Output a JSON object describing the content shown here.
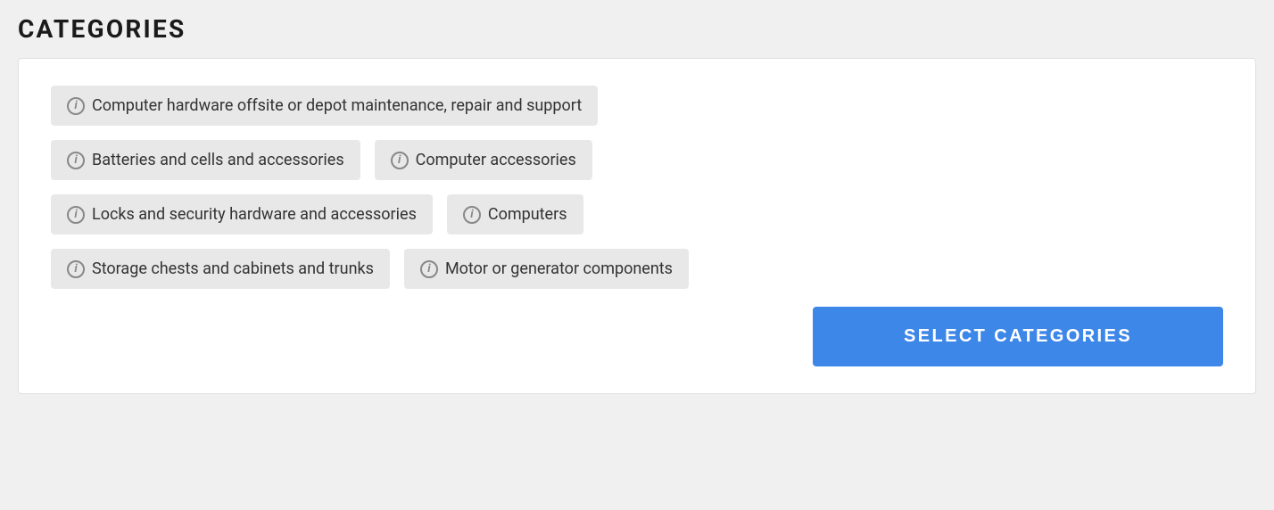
{
  "page": {
    "title": "CATEGORIES"
  },
  "categories": {
    "rows": [
      {
        "items": [
          {
            "label": "Computer hardware offsite or depot maintenance, repair and support"
          }
        ]
      },
      {
        "items": [
          {
            "label": "Batteries and cells and accessories"
          },
          {
            "label": "Computer accessories"
          }
        ]
      },
      {
        "items": [
          {
            "label": "Locks and security hardware and accessories"
          },
          {
            "label": "Computers"
          }
        ]
      },
      {
        "items": [
          {
            "label": "Storage chests and cabinets and trunks"
          },
          {
            "label": "Motor or generator components"
          }
        ]
      }
    ]
  },
  "actions": {
    "select_categories_label": "SELECT CATEGORIES"
  },
  "icons": {
    "info": "i"
  }
}
